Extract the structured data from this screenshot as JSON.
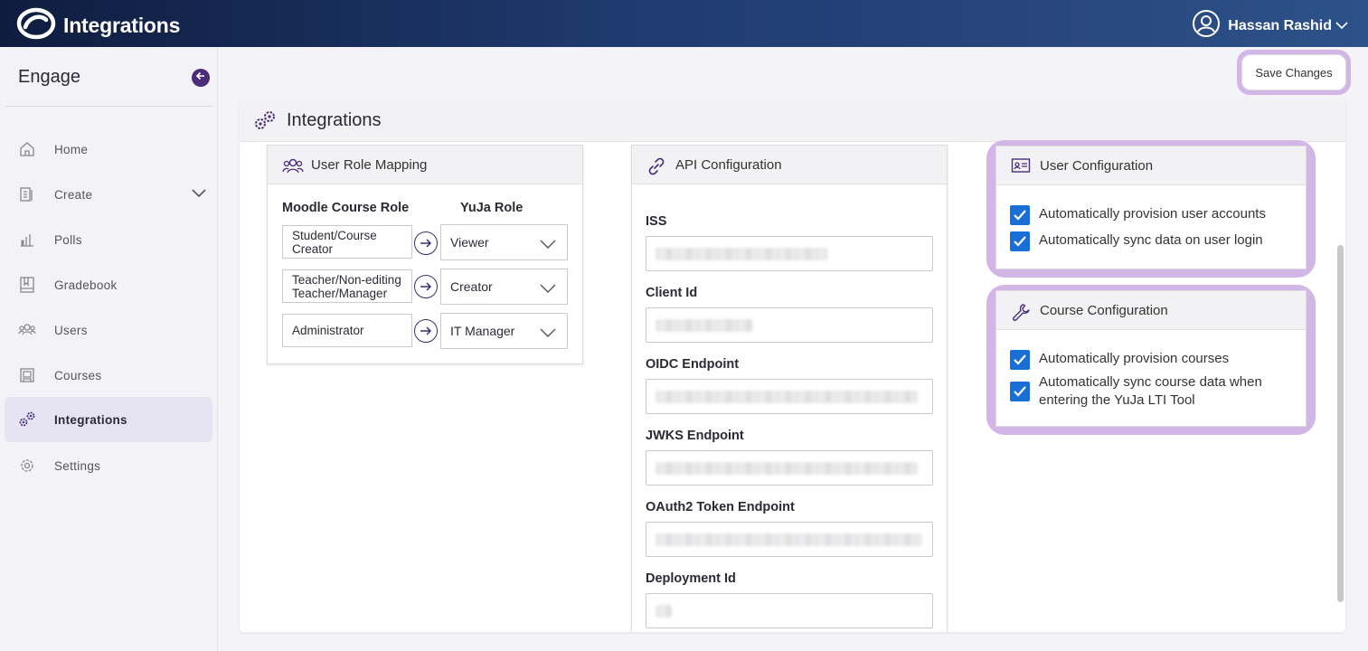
{
  "app": {
    "title": "Integrations",
    "user_name": "Hassan Rashid"
  },
  "sidebar": {
    "title": "Engage",
    "items": [
      {
        "label": "Home",
        "icon": "home-icon"
      },
      {
        "label": "Create",
        "icon": "create-icon"
      },
      {
        "label": "Polls",
        "icon": "polls-icon"
      },
      {
        "label": "Gradebook",
        "icon": "gradebook-icon"
      },
      {
        "label": "Users",
        "icon": "users-icon"
      },
      {
        "label": "Courses",
        "icon": "courses-icon"
      },
      {
        "label": "Integrations",
        "icon": "integrations-icon",
        "active": true
      },
      {
        "label": "Settings",
        "icon": "settings-icon"
      }
    ]
  },
  "toolbar": {
    "save_label": "Save Changes"
  },
  "panel": {
    "title": "Integrations"
  },
  "role_mapping": {
    "title": "User Role Mapping",
    "col_moodle": "Moodle Course Role",
    "col_yuja": "YuJa Role",
    "rows": [
      {
        "moodle": "Student/Course Creator",
        "yuja": "Viewer"
      },
      {
        "moodle": "Teacher/Non-editing Teacher/Manager",
        "yuja": "Creator"
      },
      {
        "moodle": "Administrator",
        "yuja": "IT Manager"
      }
    ]
  },
  "api_config": {
    "title": "API Configuration",
    "fields": [
      {
        "label": "ISS"
      },
      {
        "label": "Client Id"
      },
      {
        "label": "OIDC Endpoint"
      },
      {
        "label": "JWKS Endpoint"
      },
      {
        "label": "OAuth2 Token Endpoint"
      },
      {
        "label": "Deployment Id"
      }
    ]
  },
  "user_config": {
    "title": "User Configuration",
    "options": [
      {
        "label": "Automatically provision user accounts",
        "checked": true
      },
      {
        "label": "Automatically sync data on user login",
        "checked": true
      }
    ]
  },
  "course_config": {
    "title": "Course Configuration",
    "options": [
      {
        "label": "Automatically provision courses",
        "checked": true
      },
      {
        "label": "Automatically sync course data when entering the YuJa LTI Tool",
        "checked": true
      }
    ]
  },
  "colors": {
    "accent": "#4a2e7a",
    "checkbox": "#1a6fd6",
    "highlight": "#d3b6e8",
    "topbar": "#1f3a6e"
  }
}
